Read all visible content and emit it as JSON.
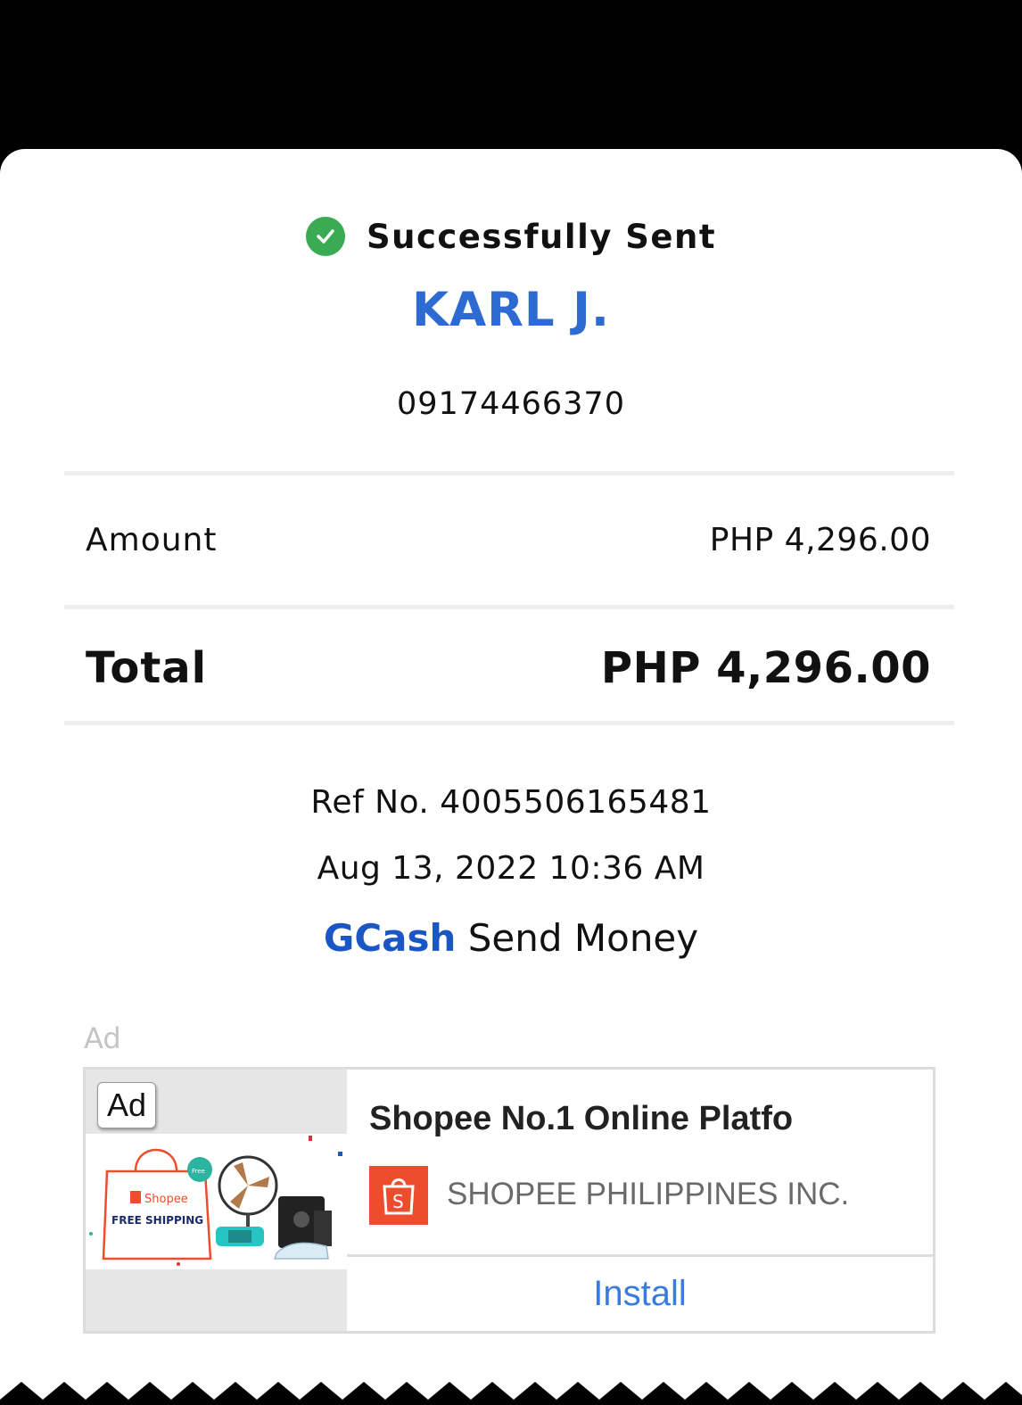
{
  "status": {
    "text": "Successfully Sent",
    "icon": "check-circle-icon",
    "color": "#3aab53"
  },
  "recipient": {
    "name": "KARL J.",
    "number": "09174466370",
    "color": "#2d6ad1"
  },
  "amount": {
    "label": "Amount",
    "value": "PHP 4,296.00"
  },
  "total": {
    "label": "Total",
    "value": "PHP 4,296.00"
  },
  "details": {
    "ref": "Ref No. 4005506165481",
    "datetime": "Aug 13, 2022 10:36 AM",
    "brand": "GCash",
    "service": "Send Money"
  },
  "ad": {
    "caption": "Ad",
    "badge": "Ad",
    "title": "Shopee No.1 Online Platfo",
    "advertiser": "SHOPEE PHILIPPINES INC.",
    "cta": "Install",
    "image_text": {
      "brand": "Shopee",
      "promo": "FREE SHIPPING",
      "tag": "Free"
    },
    "brand_color": "#ee4d2d"
  }
}
